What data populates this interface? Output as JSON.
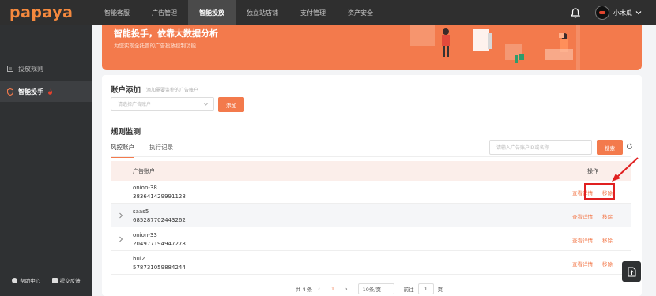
{
  "header": {
    "logo": "papaya",
    "nav": [
      "智能客服",
      "广告管理",
      "智能投放",
      "独立站店铺",
      "支付管理",
      "资产安全"
    ],
    "active_nav_index": 2,
    "username": "小木瓜"
  },
  "sidebar": {
    "items": [
      {
        "label": "投放规则",
        "icon": "rules-icon"
      },
      {
        "label": "智能投手",
        "icon": "shield-icon",
        "badge_icon": "fire-icon"
      }
    ],
    "active_index": 1,
    "bottom": {
      "help": "帮助中心",
      "feedback": "提交反馈"
    }
  },
  "banner": {
    "title": "智能投手，依靠大数据分析",
    "subtitle": "为您实现全托管的广告投放控制功能"
  },
  "account_add": {
    "title": "账户添加",
    "hint": "添加需要监控的广告账户",
    "select_placeholder": "请选择广告账户",
    "add_button": "添加"
  },
  "monitor": {
    "title": "规则监测",
    "tabs": [
      "风控账户",
      "执行记录"
    ],
    "active_tab": 0,
    "search_placeholder": "请输入广告账户ID或名称",
    "search_button": "搜索"
  },
  "table": {
    "columns": [
      "广告账户",
      "操作"
    ],
    "rows": [
      {
        "name": "onion-38",
        "account_id": "383641429991128",
        "expandable": false
      },
      {
        "name": "saas5",
        "account_id": "685287702443262",
        "expandable": true
      },
      {
        "name": "onion-33",
        "account_id": "204977194947278",
        "expandable": true
      },
      {
        "name": "hui2",
        "account_id": "578731059884244",
        "expandable": false
      }
    ],
    "action_detail": "查看详情",
    "action_remove": "移除"
  },
  "pagination": {
    "total": "共 4 条",
    "current_page": "1",
    "page_size": "10条/页",
    "goto_label": "前往",
    "goto_value": "1",
    "page_suffix": "页"
  },
  "colors": {
    "accent": "#f37a4c",
    "nav_bg": "#2f2f2f",
    "highlight": "#e02020"
  }
}
